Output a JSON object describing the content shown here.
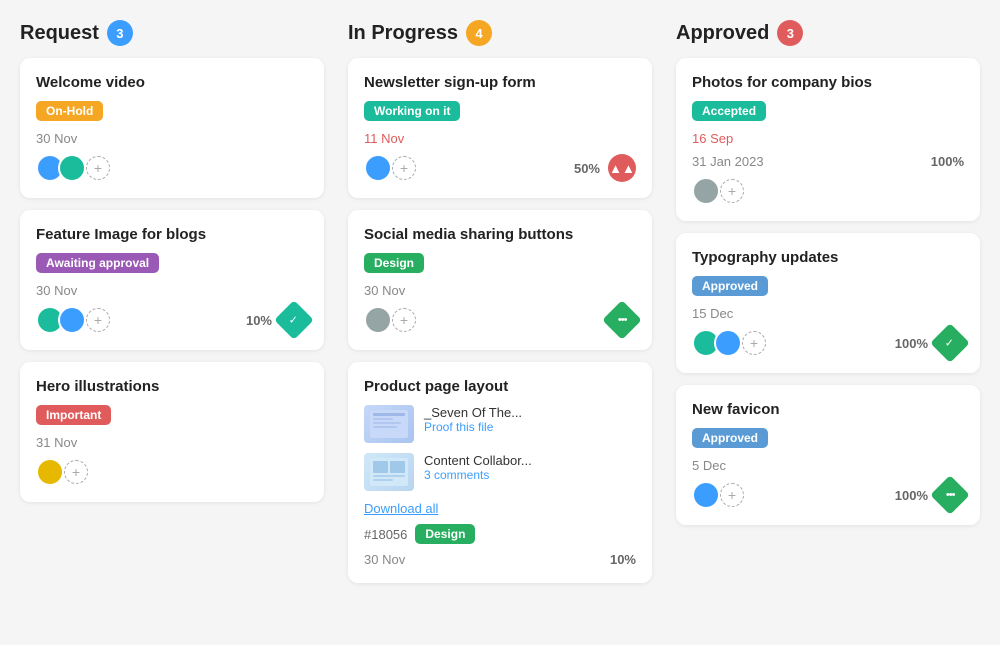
{
  "columns": [
    {
      "id": "request",
      "title": "Request",
      "badge_count": "3",
      "badge_color": "badge-blue",
      "cards": [
        {
          "id": "card-welcome-video",
          "title": "Welcome video",
          "tag": "On-Hold",
          "tag_color": "tag-orange",
          "date": "30 Nov",
          "date_red": false,
          "avatars": [
            "blue",
            "teal"
          ],
          "show_add": true,
          "percent": null,
          "icon": null
        },
        {
          "id": "card-feature-image",
          "title": "Feature Image for blogs",
          "tag": "Awaiting approval",
          "tag_color": "tag-purple",
          "date": "30 Nov",
          "date_red": false,
          "avatars": [
            "teal",
            "blue"
          ],
          "show_add": true,
          "percent": "10%",
          "icon": "diamond-teal"
        },
        {
          "id": "card-hero-illustrations",
          "title": "Hero illustrations",
          "tag": "Important",
          "tag_color": "tag-red",
          "date": "31 Nov",
          "date_red": false,
          "avatars": [
            "yellow"
          ],
          "show_add": true,
          "percent": null,
          "icon": null
        }
      ]
    },
    {
      "id": "in-progress",
      "title": "In Progress",
      "badge_count": "4",
      "badge_color": "badge-yellow",
      "cards": [
        {
          "id": "card-newsletter",
          "title": "Newsletter sign-up form",
          "tag": "Working on it",
          "tag_color": "tag-blue-green",
          "date": "11 Nov",
          "date_red": true,
          "avatars": [
            "blue"
          ],
          "show_add": true,
          "percent": "50%",
          "icon": "arrow-up",
          "files": null
        },
        {
          "id": "card-social-media",
          "title": "Social media sharing buttons",
          "tag": "Design",
          "tag_color": "tag-green",
          "date": "30 Nov",
          "date_red": false,
          "avatars": [
            "gray"
          ],
          "show_add": true,
          "percent": null,
          "icon": "dots-green",
          "files": null
        },
        {
          "id": "card-product-page",
          "title": "Product page layout",
          "tag": null,
          "tag_color": null,
          "date": "30 Nov",
          "date_red": false,
          "avatars": [],
          "show_add": false,
          "percent": "10%",
          "icon": null,
          "files": [
            {
              "name": "_Seven Of The...",
              "action": "Proof this file",
              "thumb_type": "layout"
            },
            {
              "name": "Content Collabor...",
              "action": "3 comments",
              "thumb_type": "content"
            }
          ],
          "download_label": "Download all",
          "ticket_id": "#18056",
          "ticket_tag": "Design",
          "ticket_tag_color": "tag-green"
        }
      ]
    },
    {
      "id": "approved",
      "title": "Approved",
      "badge_count": "3",
      "badge_color": "badge-red",
      "cards": [
        {
          "id": "card-photos",
          "title": "Photos for company bios",
          "tag": "Accepted",
          "tag_color": "tag-blue-green",
          "date": "16 Sep",
          "date_red": true,
          "date2": "31 Jan 2023",
          "avatars": [
            "gray"
          ],
          "show_add": true,
          "percent": "100%",
          "icon": null
        },
        {
          "id": "card-typography",
          "title": "Typography updates",
          "tag": "Approved",
          "tag_color": "tag-light-blue",
          "date": "15 Dec",
          "date_red": false,
          "avatars": [
            "teal",
            "blue"
          ],
          "show_add": true,
          "percent": "100%",
          "icon": "diamond-green"
        },
        {
          "id": "card-favicon",
          "title": "New favicon",
          "tag": "Approved",
          "tag_color": "tag-light-blue",
          "date": "5 Dec",
          "date_red": false,
          "avatars": [
            "blue"
          ],
          "show_add": true,
          "percent": "100%",
          "icon": "dots-green"
        }
      ]
    }
  ]
}
